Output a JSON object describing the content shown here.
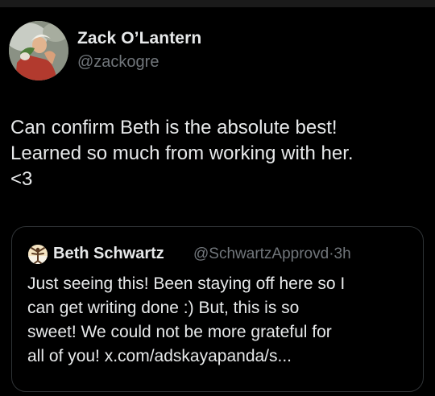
{
  "tweet": {
    "author": {
      "name": "Zack O’Lantern",
      "handle": "@zackogre",
      "avatar_icon": "profile-photo"
    },
    "text": "Can confirm Beth is the absolute best!\nLearned so much from working with her.\n<3"
  },
  "quoted_tweet": {
    "author": {
      "name": "Beth Schwartz",
      "handle": "@SchwartzApprovd",
      "avatar_icon": "profile-photo"
    },
    "time_separator": "·",
    "time": "3h",
    "text": "Just seeing this! Been staying off here so I\ncan get writing done :)  But, this is so\nsweet! We could not be more grateful for\nall of you! x.com/adskayapanda/s..."
  },
  "colors": {
    "background": "#000000",
    "primary_text": "#e7e9ea",
    "secondary_text": "#71767b",
    "card_border": "#2f3336"
  }
}
